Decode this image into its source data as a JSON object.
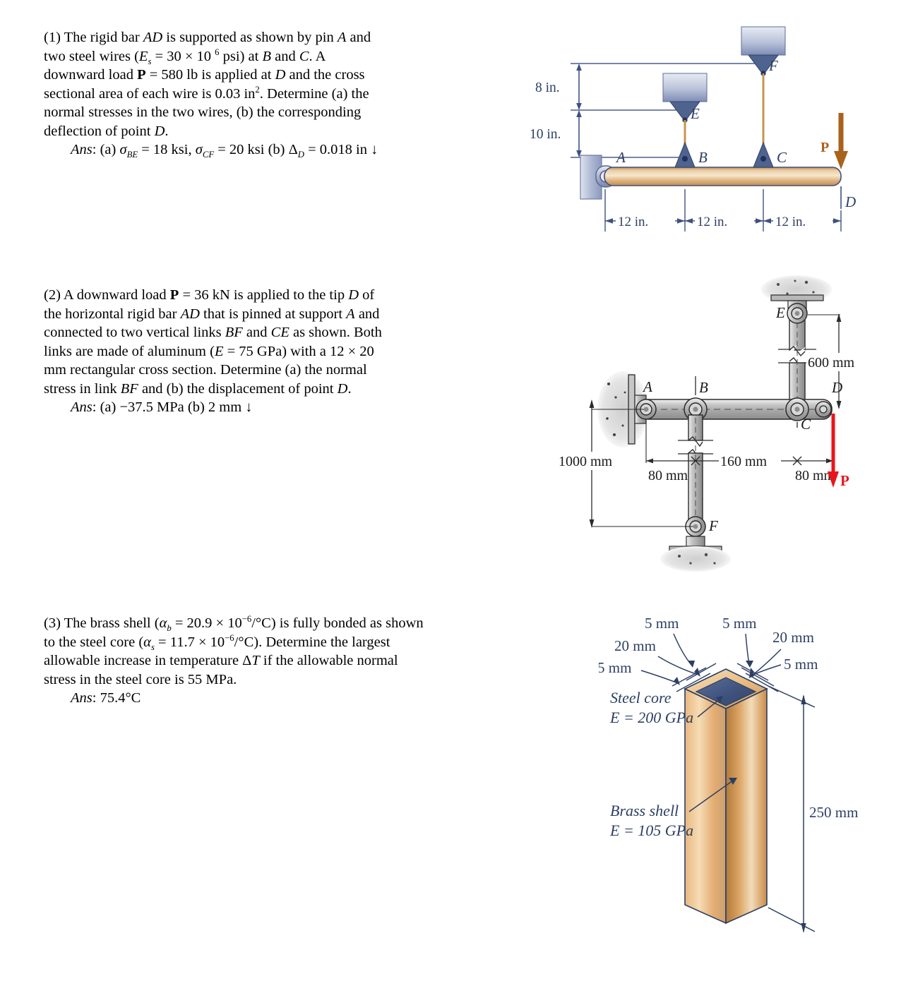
{
  "document": {
    "type": "mechanics-of-materials-problem-set",
    "page_background": "#ffffff"
  },
  "problems": [
    {
      "id": "problem-1",
      "number": "(1)",
      "lines": [
        "(1) The rigid bar AD is supported as shown by pin A and",
        "two steel wires (Es = 30 × 10 6 psi) at B and C. A",
        "downward load P = 580 lb is applied at D and the cross",
        "sectional area of each wire is 0.03 in2. Determine (a) the",
        "normal stresses in the two wires, (b) the corresponding",
        "deflection of point D."
      ],
      "answer": "Ans: (a) σBE = 18 ksi, σCF = 20 ksi (b) ΔD = 0.018 in ↓",
      "given": {
        "modulus_label": "Es = 30 × 10^6 psi",
        "load_label": "P = 580 lb",
        "area_label": "0.03 in²"
      },
      "answer_values": {
        "sigma_BE": "18 ksi",
        "sigma_CF": "20 ksi",
        "delta_D": "0.018 in"
      }
    },
    {
      "id": "problem-2",
      "number": "(2)",
      "lines": [
        "(2) A downward load P = 36 kN is applied to the tip D of",
        "the horizontal rigid bar AD that is pinned at support A and",
        "connected to two vertical links BF and CE as shown. Both",
        "links are made of aluminum (E = 75 GPa) with a 12 × 20",
        "mm rectangular cross section. Determine (a) the normal",
        "stress in link BF and (b) the displacement of point D."
      ],
      "answer": "Ans: (a) −37.5 MPa (b) 2 mm ↓",
      "given": {
        "load_label": "P = 36 kN",
        "modulus_label": "E = 75 GPa",
        "section_label": "12 × 20 mm"
      },
      "answer_values": {
        "sigma_BF": "−37.5 MPa",
        "delta_D": "2 mm"
      }
    },
    {
      "id": "problem-3",
      "number": "(3)",
      "lines": [
        "(3) The brass shell (αb = 20.9 × 10−6/°C) is fully bonded as shown",
        "to the steel core (αs = 11.7 × 10−6/°C). Determine the largest",
        "allowable increase in temperature ΔT if the allowable normal",
        "stress in the steel core is 55 MPa."
      ],
      "answer": "Ans: 75.4°C",
      "given": {
        "alpha_brass": "20.9 × 10^−6/°C",
        "alpha_steel": "11.7 × 10^−6/°C",
        "allowable_stress": "55 MPa"
      },
      "answer_values": {
        "delta_T": "75.4°C"
      }
    }
  ],
  "figures": {
    "figure1": {
      "name": "rigid-bar-AD-with-two-steel-wires",
      "points": [
        "A",
        "B",
        "C",
        "D",
        "E",
        "F"
      ],
      "vertical_dims": [
        "8 in.",
        "10 in."
      ],
      "horizontal_dims": [
        "12 in.",
        "12 in.",
        "12 in."
      ],
      "load_label": "P",
      "colors": {
        "bar": "#d9a86a",
        "wire": "#c8944c",
        "support": "#8793b8",
        "arrow": "#a9621b",
        "dim_line": "#3e5180"
      }
    },
    "figure2": {
      "name": "rigid-bar-AD-with-links-BF-and-CE",
      "points": [
        "A",
        "B",
        "C",
        "D",
        "E",
        "F"
      ],
      "dims": [
        "1000 mm",
        "600 mm",
        "80 mm",
        "160 mm",
        "80 mm"
      ],
      "load_label": "P",
      "colors": {
        "link": "#b9b9b9",
        "outline": "#2b2b2b",
        "arrow": "#e8161c",
        "dim_line": "#2b2b2b"
      }
    },
    "figure3": {
      "name": "brass-shell-bonded-to-steel-core",
      "callouts": [
        "5 mm",
        "20 mm",
        "5 mm",
        "5 mm",
        "20 mm",
        "5 mm"
      ],
      "core_label_line1": "Steel core",
      "core_label_line2": "E = 200 GPa",
      "shell_label_line1": "Brass shell",
      "shell_label_line2": "E = 105 GPa",
      "height_dim": "250 mm",
      "colors": {
        "brass_light": "#f0cfa4",
        "brass_mid": "#d9a05f",
        "brass_dark": "#bb7f3f",
        "steel_core": "#3f537e",
        "label": "#2c3f63"
      }
    }
  }
}
